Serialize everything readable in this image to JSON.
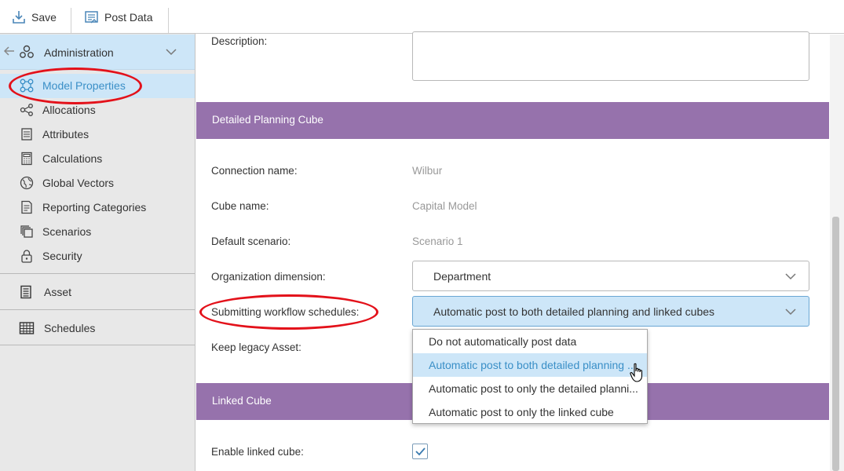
{
  "toolbar": {
    "save_label": "Save",
    "post_label": "Post Data"
  },
  "sidebar": {
    "header_label": "Administration",
    "items": [
      {
        "label": "Model Properties",
        "icon": "model-properties-icon",
        "active": true
      },
      {
        "label": "Allocations",
        "icon": "allocations-icon"
      },
      {
        "label": "Attributes",
        "icon": "attributes-icon"
      },
      {
        "label": "Calculations",
        "icon": "calculator-icon"
      },
      {
        "label": "Global Vectors",
        "icon": "globe-icon"
      },
      {
        "label": "Reporting Categories",
        "icon": "reporting-icon"
      },
      {
        "label": "Scenarios",
        "icon": "scenarios-icon"
      },
      {
        "label": "Security",
        "icon": "lock-icon"
      }
    ],
    "sections": [
      {
        "label": "Asset",
        "icon": "asset-icon"
      },
      {
        "label": "Schedules",
        "icon": "schedules-icon"
      }
    ]
  },
  "form": {
    "description_label": "Description:",
    "detailed_section_title": "Detailed Planning Cube",
    "connection_label": "Connection name:",
    "connection_value": "Wilbur",
    "cube_label": "Cube name:",
    "cube_value": "Capital Model",
    "scenario_label": "Default scenario:",
    "scenario_value": "Scenario 1",
    "org_label": "Organization dimension:",
    "org_value": "Department",
    "workflow_label": "Submitting workflow schedules:",
    "workflow_value": "Automatic post to both detailed planning and linked cubes",
    "legacy_label": "Keep legacy Asset:",
    "linked_section_title": "Linked Cube",
    "enable_linked_label": "Enable linked cube:",
    "enable_linked_checked": true
  },
  "dropdown": {
    "options": [
      "Do not automatically post data",
      "Automatic post to both detailed planning ...",
      "Automatic post to only the detailed planni...",
      "Automatic post to only the linked cube"
    ],
    "highlighted_index": 1
  },
  "colors": {
    "section_bar": "#9672ac",
    "highlight": "#cde6f8",
    "accent_text": "#3a8fc7",
    "annotation": "#e3111a"
  }
}
